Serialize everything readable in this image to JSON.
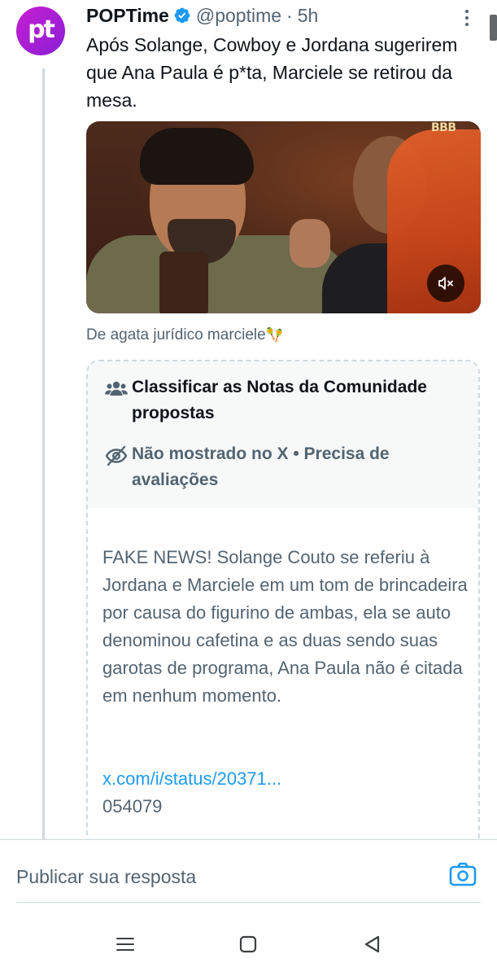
{
  "tweet": {
    "author_name": "POPTime",
    "avatar_text": "pt",
    "handle": "@poptime",
    "separator": "·",
    "time": "5h",
    "text": "Após Solange, Cowboy e Jordana sugerirem que Ana Paula é p*ta, Marciele se retirou da mesa.",
    "media_logo": "BBB",
    "caption": "De agata jurídico marciele",
    "caption_emoji": "🪇"
  },
  "community_note": {
    "header_title": "Classificar as Notas da Comunidade propostas",
    "status_text": "Não mostrado no X • Precisa de avaliações",
    "body": "FAKE NEWS! Solange Couto se referiu à Jordana e Marciele em um tom de brincadeira por causa do figurino de ambas, ela se auto denominou cafetina e as duas sendo suas garotas de programa, Ana Paula não é citada em nenhum momento.",
    "link": "x.com/i/status/20371...",
    "link_rest": "054079"
  },
  "reply": {
    "placeholder": "Publicar sua resposta"
  },
  "colors": {
    "accent": "#1d9bf0",
    "avatar": "#c51fd0",
    "text_secondary": "#536471"
  },
  "icons": {
    "verified": "verified-badge-icon",
    "more": "more-options-icon",
    "mute": "muted-speaker-icon",
    "people": "people-icon",
    "hidden": "eye-slash-icon",
    "camera": "camera-icon",
    "recents": "recents-icon",
    "home": "home-icon",
    "back": "back-icon"
  }
}
